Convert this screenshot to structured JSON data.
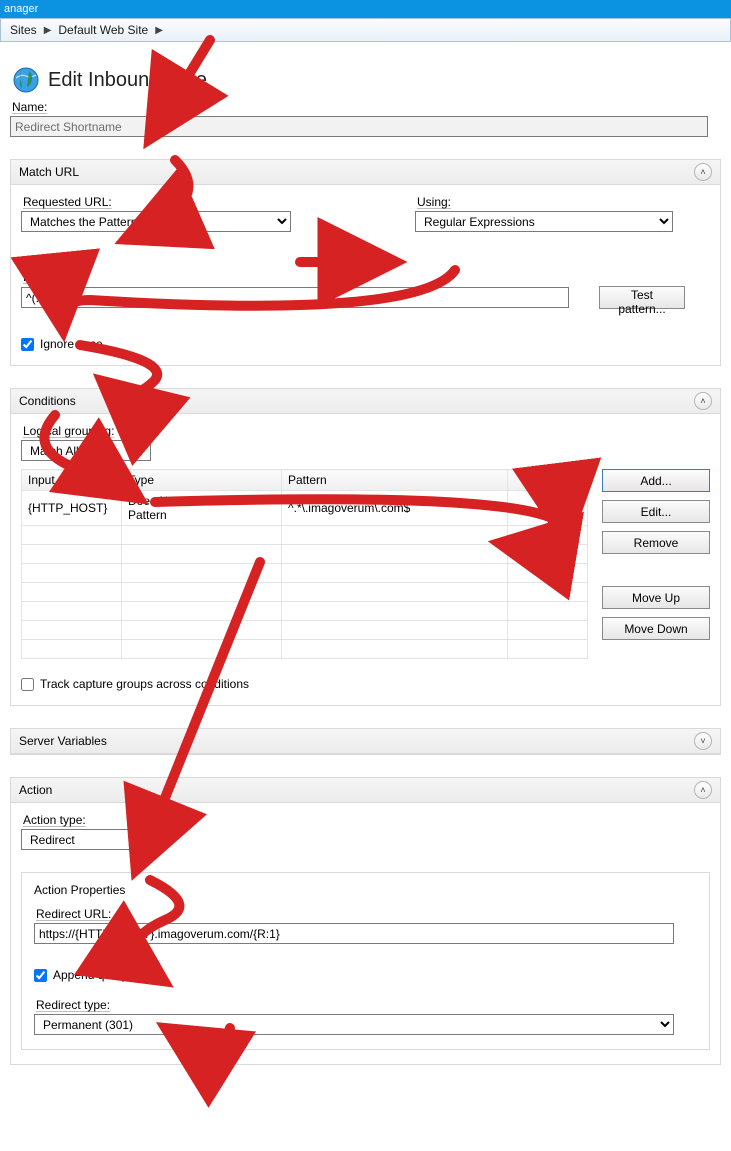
{
  "window": {
    "title_fragment": "anager"
  },
  "breadcrumb": {
    "items": [
      "Sites",
      "Default Web Site"
    ]
  },
  "page": {
    "title": "Edit Inbound Rule"
  },
  "name": {
    "label": "Name:",
    "value": "Redirect Shortname"
  },
  "sections": {
    "match_url": {
      "title": "Match URL",
      "requested_url_label": "Requested URL:",
      "requested_url_value": "Matches the Pattern",
      "using_label": "Using:",
      "using_value": "Regular Expressions",
      "pattern_label": "Pattern:",
      "pattern_value": "^(.*)$",
      "test_pattern_label": "Test pattern...",
      "ignore_case_label": "Ignore case",
      "ignore_case_checked": true
    },
    "conditions": {
      "title": "Conditions",
      "grouping_label": "Logical grouping:",
      "grouping_value": "Match All",
      "columns": {
        "input": "Input",
        "type": "Type",
        "pattern": "Pattern"
      },
      "rows": [
        {
          "input": "{HTTP_HOST}",
          "type": "Does Not Match the Pattern",
          "pattern": "^.*\\.imagoverum\\.com$"
        }
      ],
      "buttons": {
        "add": "Add...",
        "edit": "Edit...",
        "remove": "Remove",
        "move_up": "Move Up",
        "move_down": "Move Down"
      },
      "track_capture_label": "Track capture groups across conditions",
      "track_capture_checked": false
    },
    "server_variables": {
      "title": "Server Variables"
    },
    "action": {
      "title": "Action",
      "action_type_label": "Action type:",
      "action_type_value": "Redirect",
      "properties_title": "Action Properties",
      "redirect_url_label": "Redirect URL:",
      "redirect_url_value": "https://{HTTP_HOST}.imagoverum.com/{R:1}",
      "append_query_label": "Append query string",
      "append_query_checked": true,
      "redirect_type_label": "Redirect type:",
      "redirect_type_value": "Permanent (301)"
    }
  }
}
